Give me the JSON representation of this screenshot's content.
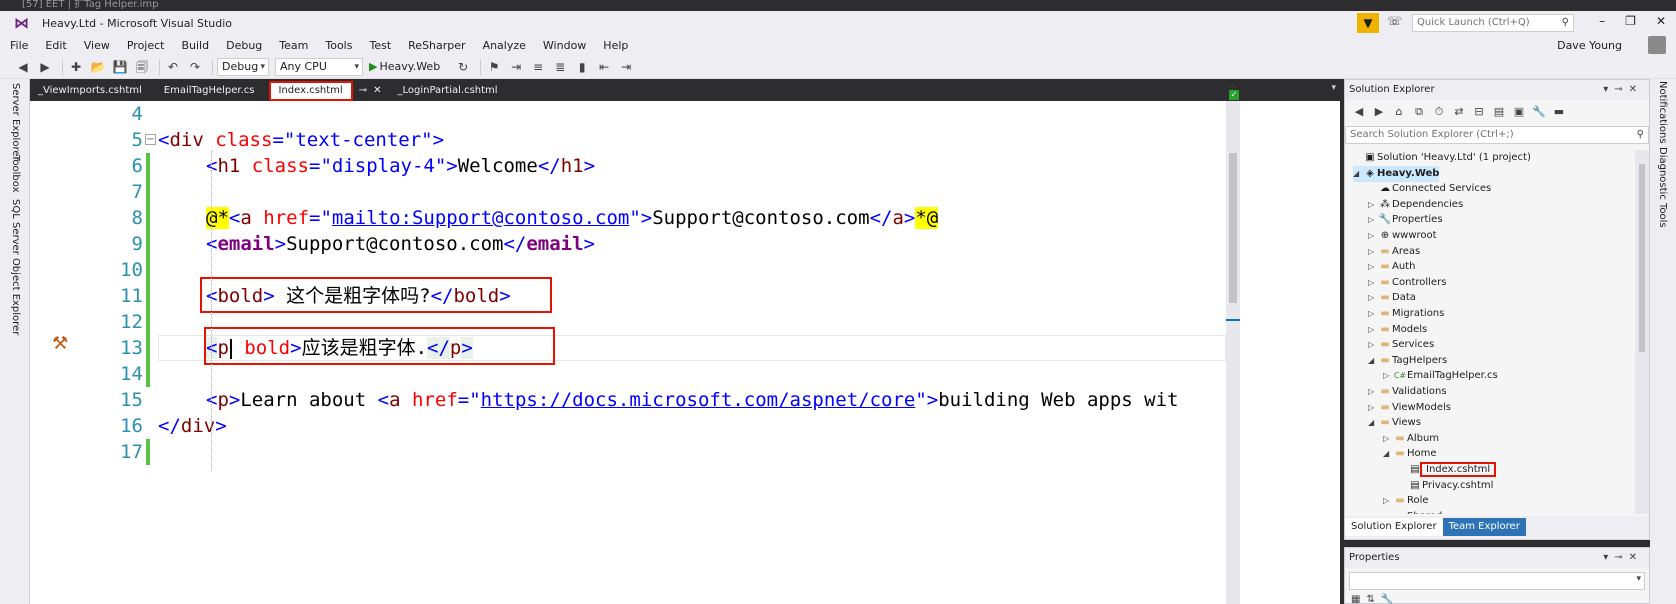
{
  "window": {
    "top_strip": "[57] EET | 扩Tag Helper.imp",
    "logo": "⋈",
    "title": "Heavy.Ltd - Microsoft Visual Studio",
    "quick_launch_placeholder": "Quick Launch (Ctrl+Q)",
    "user": "Dave Young"
  },
  "menu": [
    "File",
    "Edit",
    "View",
    "Project",
    "Build",
    "Debug",
    "Team",
    "Tools",
    "Test",
    "ReSharper",
    "Analyze",
    "Window",
    "Help"
  ],
  "toolbar": {
    "configuration": "Debug",
    "platform": "Any CPU",
    "start_target": "Heavy.Web"
  },
  "left_rail": [
    "Server Explorer",
    "Toolbox",
    "SQL Server Object Explorer"
  ],
  "right_rail": [
    "Notifications",
    "Diagnostic Tools"
  ],
  "tabs": [
    {
      "label": "_ViewImports.cshtml",
      "active": false
    },
    {
      "label": "EmailTagHelper.cs",
      "active": false
    },
    {
      "label": "Index.cshtml",
      "active": true
    },
    {
      "label": "_LoginPartial.cshtml",
      "active": false
    }
  ],
  "editor": {
    "lines": [
      {
        "n": "4"
      },
      {
        "n": "5",
        "t": [
          "<",
          "div",
          " ",
          "class",
          "=\"",
          "text-center",
          "\">"
        ]
      },
      {
        "n": "6",
        "t": [
          "<",
          "h1",
          " ",
          "class",
          "=\"",
          "display-4",
          "\">",
          "Welcome",
          "</",
          "h1",
          ">"
        ]
      },
      {
        "n": "7"
      },
      {
        "n": "8",
        "t": [
          "@*",
          "<",
          "a",
          " ",
          "href",
          "=\"",
          "mailto:Support@contoso.com",
          "\">",
          "Support@contoso.com",
          "</",
          "a",
          ">",
          "*@"
        ]
      },
      {
        "n": "9",
        "t": [
          "<",
          "email",
          ">",
          "Support@contoso.com",
          "</",
          "email",
          ">"
        ]
      },
      {
        "n": "10"
      },
      {
        "n": "11",
        "t": [
          "<",
          "bold",
          ">",
          " 这个是粗字体吗?",
          "</",
          "bold",
          ">"
        ]
      },
      {
        "n": "12"
      },
      {
        "n": "13",
        "t": [
          "<",
          "p",
          " ",
          "bold",
          ">",
          "应该是粗字体.",
          "</",
          "p",
          ">"
        ]
      },
      {
        "n": "14"
      },
      {
        "n": "15",
        "t": [
          "<",
          "p",
          ">",
          "Learn about ",
          "<",
          "a",
          " ",
          "href",
          "=\"",
          "https://docs.microsoft.com/aspnet/core",
          "\">",
          "building Web apps wit"
        ]
      },
      {
        "n": "16",
        "t": [
          "</",
          "div",
          ">"
        ]
      },
      {
        "n": "17"
      }
    ]
  },
  "solution_explorer": {
    "title": "Solution Explorer",
    "search_placeholder": "Search Solution Explorer (Ctrl+;)",
    "items": [
      {
        "label": "Solution 'Heavy.Ltd' (1 project)",
        "icon": "solution-icon"
      },
      {
        "label": "Heavy.Web",
        "icon": "web-project-icon"
      },
      {
        "label": "Connected Services",
        "icon": "connected-services-icon"
      },
      {
        "label": "Dependencies",
        "icon": "dependencies-icon"
      },
      {
        "label": "Properties",
        "icon": "wrench-icon"
      },
      {
        "label": "wwwroot",
        "icon": "globe-icon"
      },
      {
        "label": "Areas",
        "icon": "folder-icon"
      },
      {
        "label": "Auth",
        "icon": "folder-icon"
      },
      {
        "label": "Controllers",
        "icon": "folder-icon"
      },
      {
        "label": "Data",
        "icon": "folder-icon"
      },
      {
        "label": "Migrations",
        "icon": "folder-icon"
      },
      {
        "label": "Models",
        "icon": "folder-icon"
      },
      {
        "label": "Services",
        "icon": "folder-icon"
      },
      {
        "label": "TagHelpers",
        "icon": "folder-icon"
      },
      {
        "label": "EmailTagHelper.cs",
        "icon": "csharp-file-icon"
      },
      {
        "label": "Validations",
        "icon": "folder-icon"
      },
      {
        "label": "ViewModels",
        "icon": "folder-icon"
      },
      {
        "label": "Views",
        "icon": "folder-icon"
      },
      {
        "label": "Album",
        "icon": "folder-icon"
      },
      {
        "label": "Home",
        "icon": "folder-icon"
      },
      {
        "label": "Index.cshtml",
        "icon": "razor-file-icon"
      },
      {
        "label": "Privacy.cshtml",
        "icon": "razor-file-icon"
      },
      {
        "label": "Role",
        "icon": "folder-icon"
      },
      {
        "label": "Shared",
        "icon": "folder-icon"
      }
    ],
    "bottom_tabs": [
      "Solution Explorer",
      "Team Explorer"
    ]
  },
  "properties": {
    "title": "Properties"
  },
  "colors": {
    "highlight_box": "#e51400",
    "change_bar": "#57c444",
    "razor_bg": "#ffff00"
  }
}
